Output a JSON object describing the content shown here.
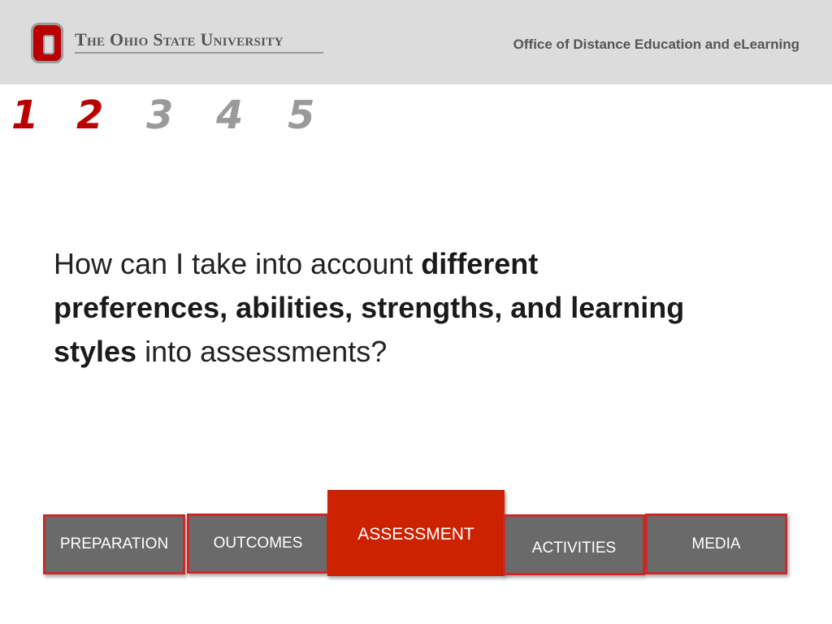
{
  "header": {
    "university": "The Ohio State University",
    "office": "Office of Distance Education and eLearning",
    "background_color": "#dcdcdc",
    "brand_color": "#bb0000"
  },
  "steps": {
    "items": [
      "1",
      "2",
      "3",
      "4",
      "5"
    ],
    "active": [
      true,
      true,
      false,
      false,
      false
    ],
    "active_color": "#bb0000",
    "inactive_color": "#9a9a9a"
  },
  "question": {
    "part1": "How can I take into account ",
    "bold1": "different preferences, abilities, strengths, and learning styles",
    "part2": " into assessments?"
  },
  "tabs": {
    "items": [
      {
        "label": "PREPARATION",
        "active": false
      },
      {
        "label": "OUTCOMES",
        "active": false
      },
      {
        "label": "ASSESSMENT",
        "active": true
      },
      {
        "label": "ACTIVITIES",
        "active": false
      },
      {
        "label": "MEDIA",
        "active": false
      }
    ],
    "inactive_color": "#6a6a6a",
    "active_color": "#cc2200",
    "border_color": "#cc2a2a"
  }
}
